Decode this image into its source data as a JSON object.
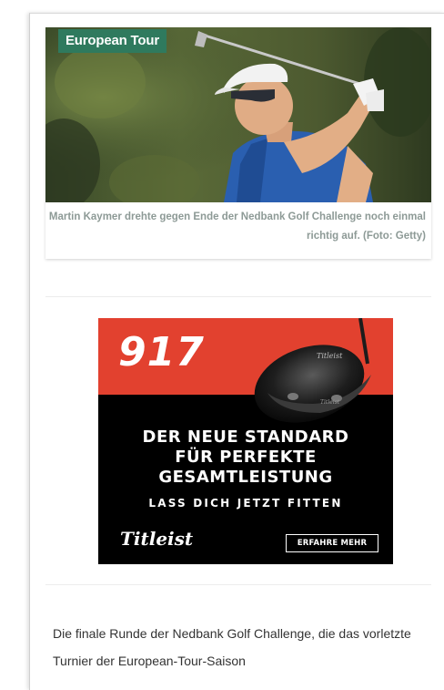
{
  "article": {
    "tag": "European Tour",
    "caption": "Martin Kaymer drehte gegen Ende der Nedbank Golf Challenge noch einmal richtig auf. (Foto: Getty)",
    "body": "Die finale Runde der Nedbank Golf Challenge, die das vorletzte Turnier der European-Tour-Saison"
  },
  "ad": {
    "model": "917",
    "headline_1": "DER NEUE STANDARD",
    "headline_2": "FÜR PERFEKTE",
    "headline_3": "GESAMTLEISTUNG",
    "subline": "LASS DICH JETZT FITTEN",
    "brand": "Titleist",
    "cta": "ERFAHRE MEHR",
    "colors": {
      "top": "#e2412f",
      "bottom": "#000000"
    }
  },
  "colors": {
    "tag_bg": "#2f7a5e",
    "caption": "#8d9a96",
    "body_text": "#333333"
  }
}
